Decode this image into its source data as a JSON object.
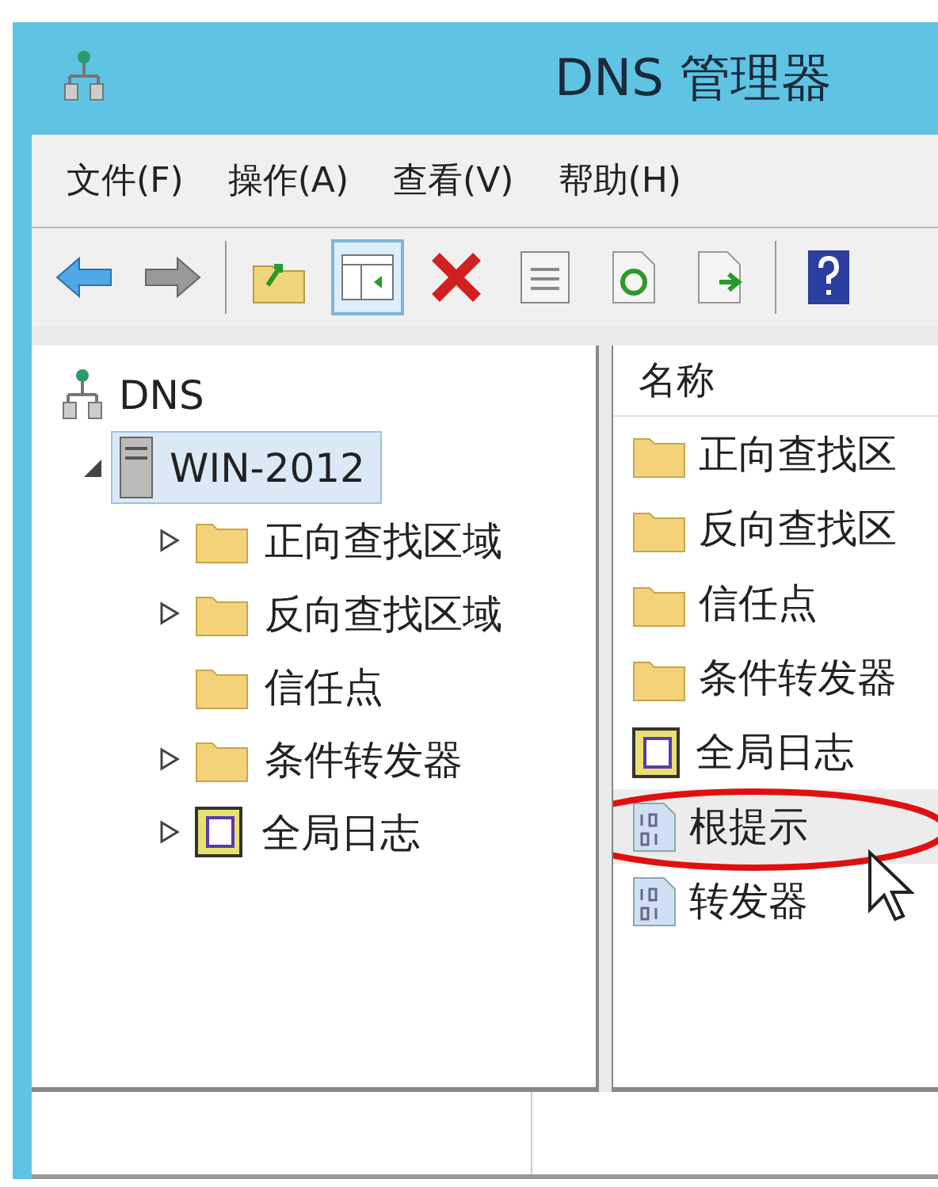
{
  "window": {
    "title": "DNS 管理器"
  },
  "menu": [
    "文件(F)",
    "操作(A)",
    "查看(V)",
    "帮助(H)"
  ],
  "toolbar": [
    {
      "kind": "back",
      "pressed": false
    },
    {
      "kind": "forward",
      "pressed": false
    },
    {
      "kind": "separator"
    },
    {
      "kind": "up",
      "pressed": false
    },
    {
      "kind": "tree",
      "pressed": true
    },
    {
      "kind": "delete",
      "pressed": false
    },
    {
      "kind": "properties",
      "pressed": false
    },
    {
      "kind": "refresh",
      "pressed": false
    },
    {
      "kind": "export",
      "pressed": false
    },
    {
      "kind": "separator"
    },
    {
      "kind": "help",
      "pressed": false
    }
  ],
  "tree": [
    {
      "label": "DNS",
      "kind": "dns",
      "selected": false,
      "children": [
        {
          "label": "WIN-2012",
          "kind": "server",
          "expandable": true,
          "expanded": true,
          "selected": true,
          "children": [
            {
              "label": "正向查找区域",
              "kind": "folder",
              "expandable": true,
              "expanded": false,
              "selected": false
            },
            {
              "label": "反向查找区域",
              "kind": "folder",
              "expandable": true,
              "expanded": false,
              "selected": false
            },
            {
              "label": "信任点",
              "kind": "folder",
              "expandable": false,
              "selected": false
            },
            {
              "label": "条件转发器",
              "kind": "folder",
              "expandable": true,
              "expanded": false,
              "selected": false
            },
            {
              "label": "全局日志",
              "kind": "log",
              "expandable": true,
              "expanded": false,
              "selected": false
            }
          ]
        }
      ]
    }
  ],
  "list": {
    "columns": [
      "名称"
    ],
    "items": [
      {
        "label": "正向查找区",
        "kind": "folder",
        "selected": false
      },
      {
        "label": "反向查找区",
        "kind": "folder",
        "selected": false
      },
      {
        "label": "信任点",
        "kind": "folder",
        "selected": false
      },
      {
        "label": "条件转发器",
        "kind": "folder",
        "selected": false
      },
      {
        "label": "全局日志",
        "kind": "log",
        "selected": false
      },
      {
        "label": "根提示",
        "kind": "file",
        "selected": true
      },
      {
        "label": "转发器",
        "kind": "file",
        "selected": false
      }
    ]
  }
}
